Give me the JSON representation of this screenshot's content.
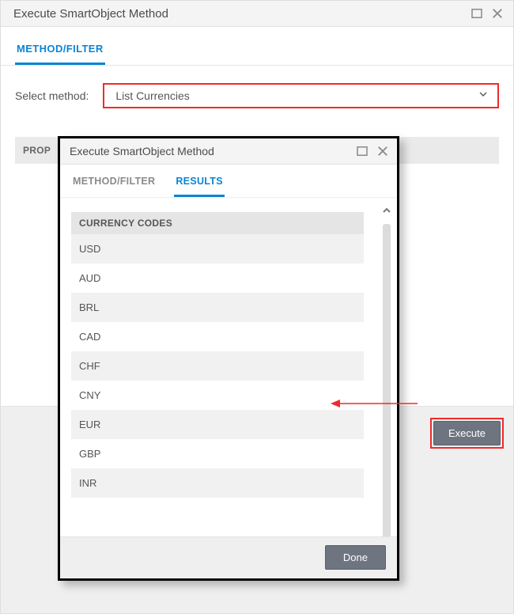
{
  "outer": {
    "title": "Execute SmartObject Method",
    "tabs": {
      "method_filter": "METHOD/FILTER"
    },
    "select_label": "Select method:",
    "select_value": "List Currencies",
    "properties_label": "PROP",
    "execute_label": "Execute"
  },
  "inner": {
    "title": "Execute SmartObject Method",
    "tabs": {
      "method_filter": "METHOD/FILTER",
      "results": "RESULTS"
    },
    "column_header": "CURRENCY CODES",
    "rows": [
      "USD",
      "AUD",
      "BRL",
      "CAD",
      "CHF",
      "CNY",
      "EUR",
      "GBP",
      "INR"
    ],
    "done_label": "Done"
  }
}
